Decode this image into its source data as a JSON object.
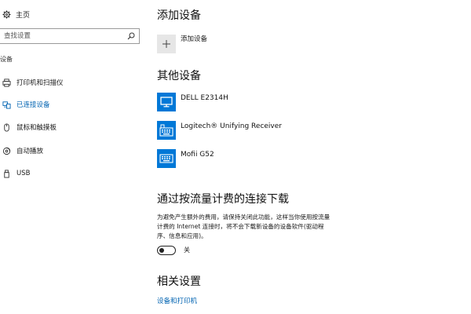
{
  "sidebar": {
    "home_label": "主页",
    "search": {
      "placeholder": "查找设置"
    },
    "section_label": "设备",
    "items": [
      {
        "label": "打印机和扫描仪",
        "icon": "printer-icon"
      },
      {
        "label": "已连接设备",
        "icon": "connected-devices-icon",
        "active": true
      },
      {
        "label": "鼠标和触摸板",
        "icon": "mouse-icon"
      },
      {
        "label": "自动播放",
        "icon": "autoplay-icon"
      },
      {
        "label": "USB",
        "icon": "usb-icon"
      }
    ]
  },
  "main": {
    "add_section_title": "添加设备",
    "add_device_label": "添加设备",
    "other_section_title": "其他设备",
    "devices": [
      {
        "name": "DELL E2314H",
        "icon": "monitor-icon"
      },
      {
        "name": "Logitech® Unifying Receiver",
        "icon": "receiver-icon"
      },
      {
        "name": "Mofii G52",
        "icon": "keyboard-icon"
      }
    ],
    "metered_title": "通过按流量计费的连接下载",
    "metered_description": [
      "为避免产生额外的费用，请保持关闭此功能，这样当你使用按流量",
      "计费的 Internet 连接时，将不会下载新设备的设备软件(驱动程",
      "序、信息和应用)。"
    ],
    "toggle": {
      "state_label": "关",
      "on": false
    },
    "related_title": "相关设置",
    "related_link": "设备和打印机"
  },
  "colors": {
    "accent": "#0078d7",
    "link": "#0063b1",
    "tile_gray": "#e6e6e6"
  }
}
